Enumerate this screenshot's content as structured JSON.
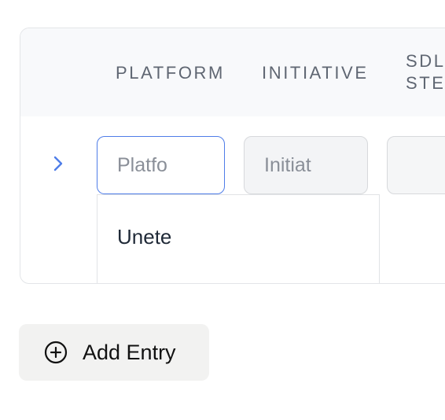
{
  "table": {
    "columns": [
      {
        "label": "PLATFORM"
      },
      {
        "label": "INITIATIVE"
      },
      {
        "label": "SDL\nSTE"
      }
    ],
    "row": {
      "platform_placeholder": "Platfo",
      "initiative_placeholder": "Initiat",
      "sdl_placeholder": ""
    },
    "dropdown": {
      "options": [
        "Unete"
      ]
    }
  },
  "actions": {
    "add_entry_label": "Add Entry"
  },
  "icons": {
    "expand": "chevron-right-icon",
    "add": "plus-circle-icon"
  },
  "colors": {
    "accent": "#4f7de8",
    "header_bg": "#f8f9fb",
    "button_bg": "#f2f2f1"
  }
}
